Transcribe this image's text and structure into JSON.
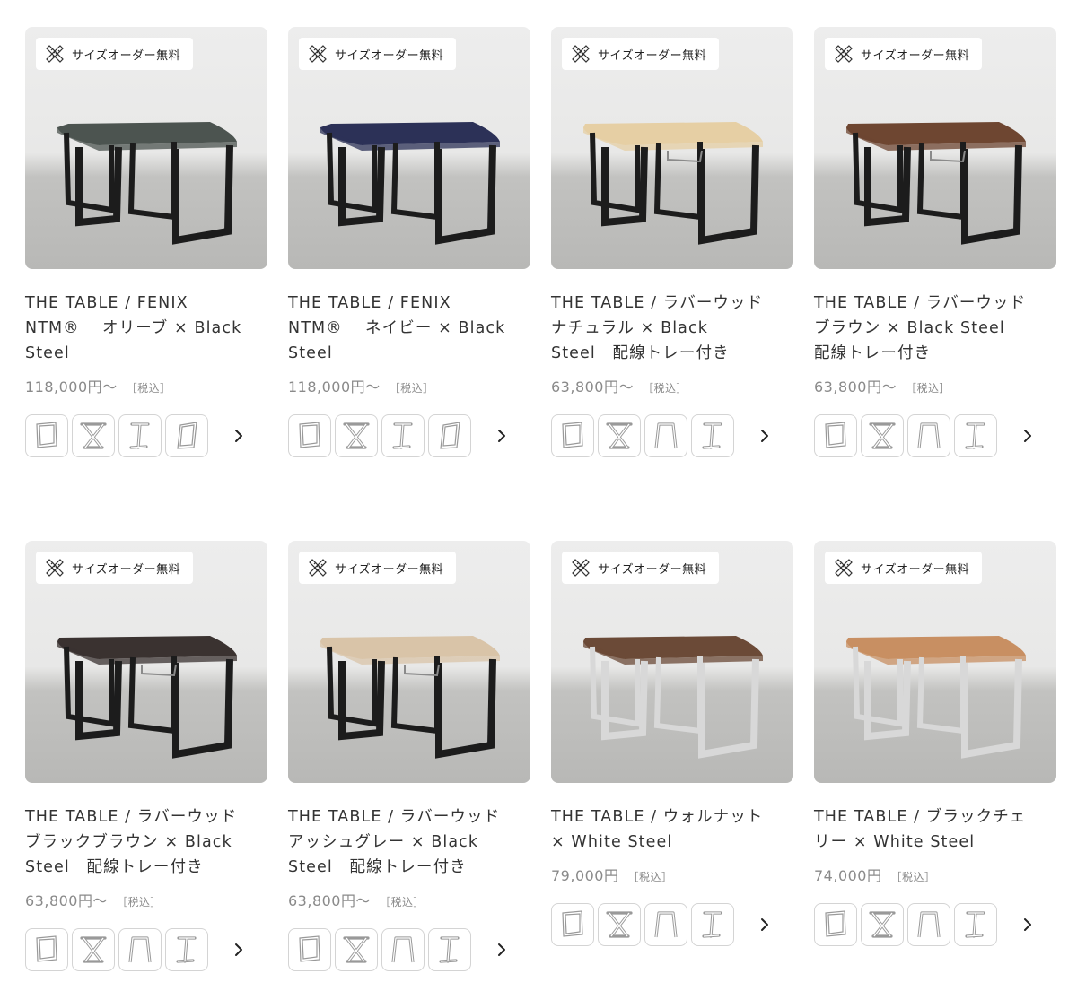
{
  "badge_label": "サイズオーダー無料",
  "tax_label": "［税込］",
  "products": [
    {
      "title_lines": [
        "THE TABLE / FENIX",
        "NTM®　 オリーブ × Black",
        "Steel"
      ],
      "price": "118,000円〜",
      "legs": [
        "square-leg-icon",
        "x-leg-icon",
        "i-leg-icon",
        "slanted-leg-icon"
      ],
      "top_color": "#4c5450",
      "leg_color": "#1c1c1c",
      "tray": false,
      "rounded": true
    },
    {
      "title_lines": [
        "THE TABLE / FENIX",
        "NTM®　 ネイビー × Black",
        "Steel"
      ],
      "price": "118,000円〜",
      "legs": [
        "square-leg-icon",
        "x-leg-icon",
        "i-leg-icon",
        "slanted-leg-icon"
      ],
      "top_color": "#2c3157",
      "leg_color": "#1c1c1c",
      "tray": false,
      "rounded": true
    },
    {
      "title_lines": [
        "THE TABLE / ラバーウッド",
        "ナチュラル × Black",
        "Steel　配線トレー付き"
      ],
      "price": "63,800円〜",
      "legs": [
        "square-leg-icon",
        "x-leg-icon",
        "trapezoid-leg-icon",
        "i-leg-icon"
      ],
      "top_color": "#e6cfa4",
      "leg_color": "#1c1c1c",
      "tray": true,
      "rounded": false
    },
    {
      "title_lines": [
        "THE TABLE / ラバーウッド",
        "ブラウン × Black Steel",
        "配線トレー付き"
      ],
      "price": "63,800円〜",
      "legs": [
        "square-leg-icon",
        "x-leg-icon",
        "trapezoid-leg-icon",
        "i-leg-icon"
      ],
      "top_color": "#6e4631",
      "leg_color": "#1c1c1c",
      "tray": true,
      "rounded": false
    },
    {
      "title_lines": [
        "THE TABLE / ラバーウッド",
        "ブラックブラウン × Black",
        "Steel　配線トレー付き"
      ],
      "price": "63,800円〜",
      "legs": [
        "square-leg-icon",
        "x-leg-icon",
        "trapezoid-leg-icon",
        "i-leg-icon"
      ],
      "top_color": "#3a3230",
      "leg_color": "#1c1c1c",
      "tray": true,
      "rounded": false
    },
    {
      "title_lines": [
        "THE TABLE / ラバーウッド",
        "アッシュグレー × Black",
        "Steel　配線トレー付き"
      ],
      "price": "63,800円〜",
      "legs": [
        "square-leg-icon",
        "x-leg-icon",
        "trapezoid-leg-icon",
        "i-leg-icon"
      ],
      "top_color": "#d9c4a8",
      "leg_color": "#1c1c1c",
      "tray": true,
      "rounded": false
    },
    {
      "title_lines": [
        "THE TABLE / ウォルナット",
        "× White Steel"
      ],
      "price": "79,000円",
      "legs": [
        "square-leg-icon",
        "x-leg-icon",
        "trapezoid-leg-icon",
        "i-leg-icon"
      ],
      "top_color": "#6b4a37",
      "leg_color": "#f5f5f5",
      "tray": false,
      "rounded": false
    },
    {
      "title_lines": [
        "THE TABLE / ブラックチェ",
        "リー × White Steel"
      ],
      "price": "74,000円",
      "legs": [
        "square-leg-icon",
        "x-leg-icon",
        "trapezoid-leg-icon",
        "i-leg-icon"
      ],
      "top_color": "#c88f62",
      "leg_color": "#f5f5f5",
      "tray": false,
      "rounded": false
    }
  ]
}
